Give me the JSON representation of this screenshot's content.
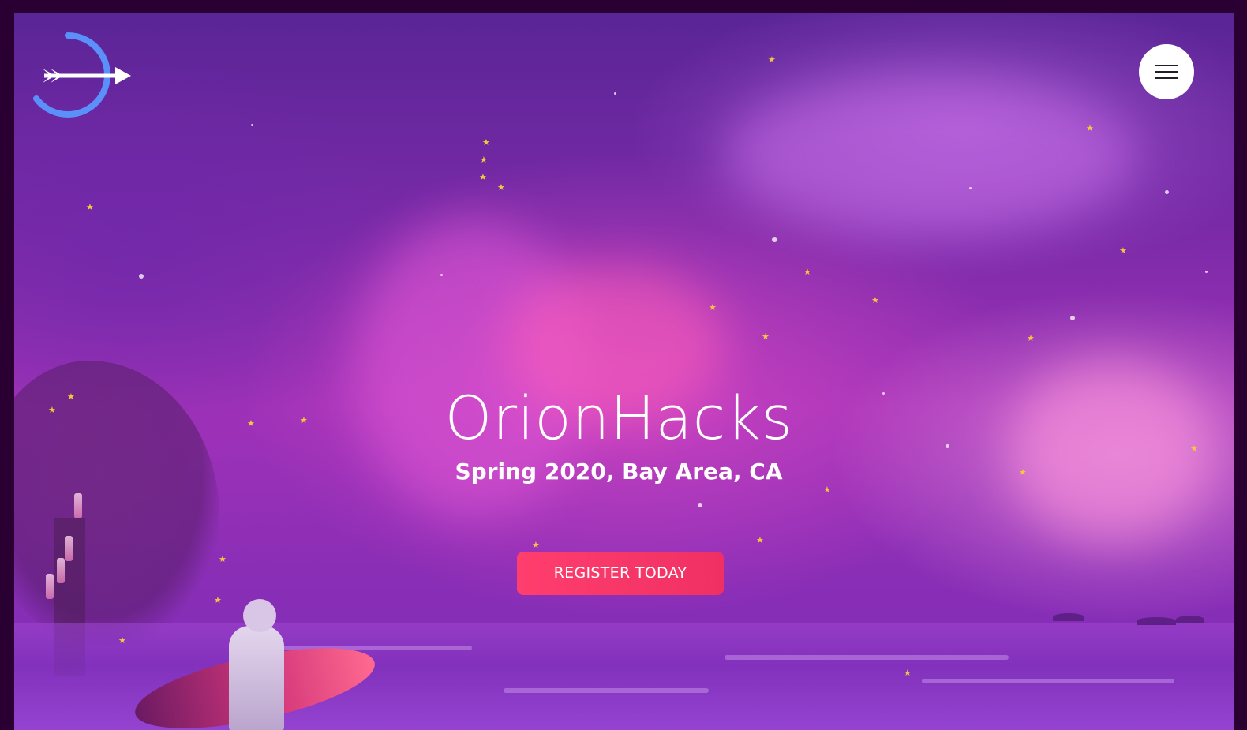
{
  "header": {
    "logo_icon": "orion-bow-arrow-icon",
    "menu_icon": "hamburger-menu-icon"
  },
  "hero": {
    "title": "OrionHacks",
    "subtitle": "Spring 2020, Bay Area, CA",
    "cta_label": "REGISTER TODAY"
  },
  "colors": {
    "page_border": "#2a0033",
    "logo_blue": "#5b8ff9",
    "cta_red": "#f03063",
    "star_gold": "#f3c93c",
    "text_white": "#ffffff"
  }
}
